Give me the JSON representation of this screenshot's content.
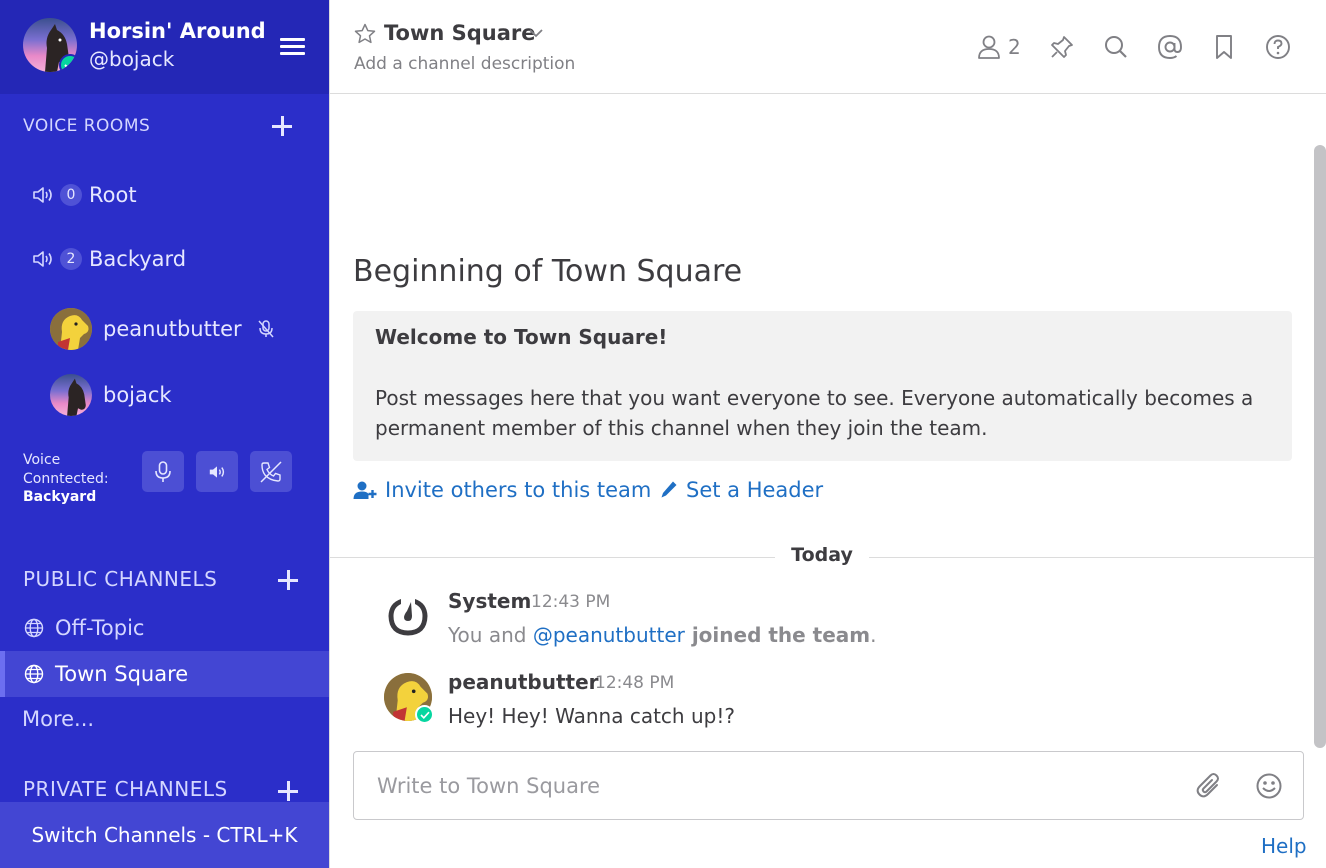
{
  "sidebar": {
    "team_name": "Horsin' Around",
    "username": "@bojack",
    "voice_rooms": {
      "title": "VOICE ROOMS",
      "rooms": [
        {
          "count": "0",
          "name": "Root"
        },
        {
          "count": "2",
          "name": "Backyard"
        }
      ],
      "users": [
        {
          "name": "peanutbutter",
          "muted": true
        },
        {
          "name": "bojack",
          "muted": false
        }
      ],
      "connected_label": "Voice Conntected:",
      "connected_room": "Backyard"
    },
    "public_channels": {
      "title": "PUBLIC CHANNELS",
      "items": [
        {
          "name": "Off-Topic",
          "active": false
        },
        {
          "name": "Town Square",
          "active": true
        }
      ],
      "more": "More..."
    },
    "private_channels": {
      "title": "PRIVATE CHANNELS"
    },
    "switch_channels": "Switch Channels - CTRL+K"
  },
  "header": {
    "channel_name": "Town Square",
    "description": "Add a channel description",
    "member_count": "2"
  },
  "intro": {
    "title": "Beginning of Town Square",
    "welcome_title": "Welcome to Town Square!",
    "welcome_body": "Post messages here that you want everyone to see. Everyone automatically becomes a permanent member of this channel when they join the team.",
    "invite_link": "Invite others to this team",
    "header_link": "Set a Header"
  },
  "date_separator": "Today",
  "posts": [
    {
      "user": "System",
      "time": "12:43 PM",
      "text_prefix": "You and ",
      "mention": "@peanutbutter",
      "text_suffix": " joined the team",
      "text_end": "."
    },
    {
      "user": "peanutbutter",
      "time": "12:48 PM",
      "text": "Hey! Hey! Wanna catch up!?"
    }
  ],
  "composer": {
    "placeholder": "Write to Town Square"
  },
  "help": "Help",
  "colors": {
    "sidebar_bg": "#2b2ec9",
    "sidebar_header_bg": "#2427b6",
    "online_status": "#06d6a0",
    "link": "#1f6fc4"
  }
}
